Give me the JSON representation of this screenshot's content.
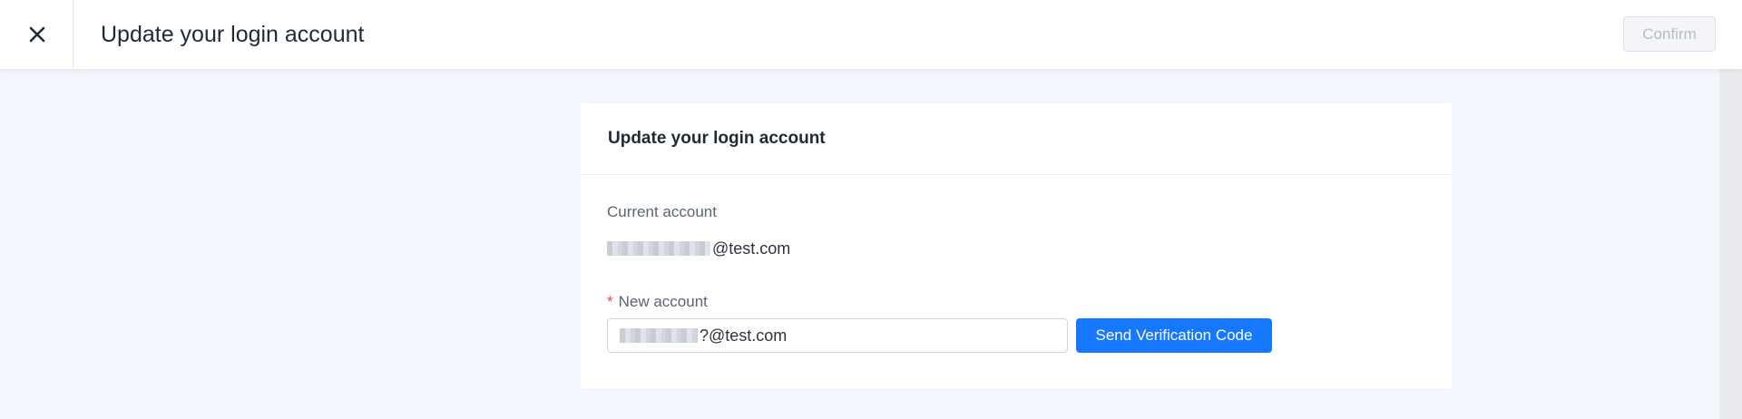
{
  "header": {
    "title": "Update your login account",
    "close_icon": "close-icon",
    "confirm_label": "Confirm"
  },
  "card": {
    "title": "Update your login account",
    "current_account": {
      "label": "Current account",
      "value_suffix": "@test.com"
    },
    "new_account": {
      "required_mark": "*",
      "label": "New account",
      "value_suffix": "?@test.com"
    },
    "send_code_label": "Send Verification Code"
  },
  "colors": {
    "primary": "#1677ff",
    "page_background": "#f3f6fc",
    "required": "#f04438"
  }
}
